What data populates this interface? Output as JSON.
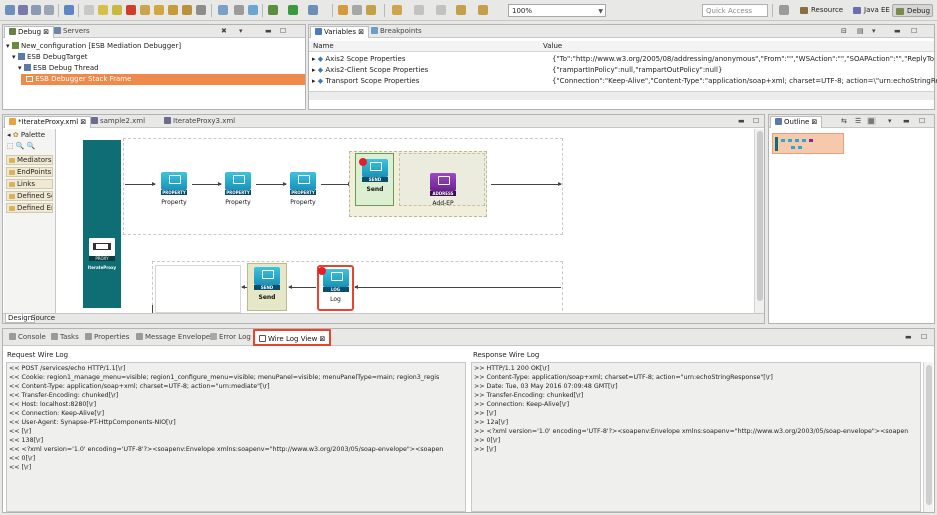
{
  "toolbar": {
    "zoom": "100%",
    "quick_access_placeholder": "Quick Access",
    "perspectives": [
      "Resource",
      "Java EE",
      "Debug"
    ]
  },
  "debug_panel": {
    "tabs": [
      "Debug",
      "Servers"
    ],
    "tree": [
      "New_configuration [ESB Mediation Debugger]",
      "ESB DebugTarget",
      "ESB Debug Thread",
      "ESB Debugger Stack Frame"
    ]
  },
  "variables_panel": {
    "tabs": [
      "Variables",
      "Breakpoints"
    ],
    "columns": [
      "Name",
      "Value"
    ],
    "rows": [
      {
        "name": "Axis2 Scope Properties",
        "value": "{\"To\":\"http://www.w3.org/2005/08/addressing/anonymous\",\"From\":\"\",\"WSAction\":\"\",\"SOAPAction\":\"\",\"ReplyTo"
      },
      {
        "name": "Axis2-Client Scope Properties",
        "value": "{\"rampartInPolicy\":null,\"rampartOutPolicy\":null}"
      },
      {
        "name": "Transport Scope Properties",
        "value": "{\"Connection\":\"Keep-Alive\",\"Content-Type\":\"application/soap+xml; charset=UTF-8; action=\\\"urn:echoStringRes"
      }
    ]
  },
  "editor": {
    "tabs": [
      "*IterateProxy.xml",
      "sample2.xml",
      "IterateProxy3.xml"
    ],
    "palette_title": "Palette",
    "palette_items": [
      "Mediators",
      "EndPoints",
      "Links",
      "Defined Sequen...",
      "Defined EndPoi..."
    ],
    "proxy_label": "PROXY",
    "proxy_name": "IterateProxy",
    "nodes": [
      {
        "cap": "PROPERTY",
        "label": "Property"
      },
      {
        "cap": "PROPERTY",
        "label": "Property"
      },
      {
        "cap": "PROPERTY",
        "label": "Property"
      },
      {
        "cap": "SEND",
        "label": "Send"
      },
      {
        "cap": "ADDRESS",
        "label": "Add-EP"
      },
      {
        "cap": "SEND",
        "label": "Send"
      },
      {
        "cap": "LOG",
        "label": "Log"
      }
    ],
    "bottom_tabs": [
      "Design",
      "Source"
    ]
  },
  "outline_panel": {
    "title": "Outline"
  },
  "bottom_panel": {
    "tabs": [
      "Console",
      "Tasks",
      "Properties",
      "Message Envelope",
      "Error Log",
      "Wire Log View"
    ],
    "request_title": "Request Wire Log",
    "request_lines": [
      "<< POST /services/echo HTTP/1.1[\\r]",
      "<< Cookie: region1_manage_menu=visible; region1_configure_menu=visible; menuPanel=visible; menuPanelType=main; region3_regis",
      "<< Content-Type: application/soap+xml; charset=UTF-8; action=\"urn:mediate\"[\\r]",
      "<< Transfer-Encoding: chunked[\\r]",
      "<< Host: localhost:8280[\\r]",
      "<< Connection: Keep-Alive[\\r]",
      "<< User-Agent: Synapse-PT-HttpComponents-NIO[\\r]",
      "<< [\\r]",
      "<< 138[\\r]",
      "<< <?xml version='1.0' encoding='UTF-8'?><soapenv:Envelope xmlns:soapenv=\"http://www.w3.org/2003/05/soap-envelope\"><soapen",
      "<< 0[\\r]",
      "<< [\\r]"
    ],
    "response_title": "Response Wire Log",
    "response_lines": [
      ">> HTTP/1.1 200 OK[\\r]",
      ">> Content-Type: application/soap+xml; charset=UTF-8; action=\"urn:echoStringResponse\"[\\r]",
      ">> Date: Tue, 03 May 2016 07:09:48 GMT[\\r]",
      ">> Transfer-Encoding: chunked[\\r]",
      ">> Connection: Keep-Alive[\\r]",
      ">> [\\r]",
      ">> 12a[\\r]",
      ">> <?xml version='1.0' encoding='UTF-8'?><soapenv:Envelope xmlns:soapenv=\"http://www.w3.org/2003/05/soap-envelope\"><soapen",
      ">> 0[\\r]",
      ">> [\\r]"
    ]
  },
  "colors": {
    "selection": "#f08a4b",
    "highlight_red": "#e8432d",
    "proxy_teal": "#0e6e73",
    "node_blue": "#28aacd",
    "address_purple": "#7a2a9c"
  }
}
